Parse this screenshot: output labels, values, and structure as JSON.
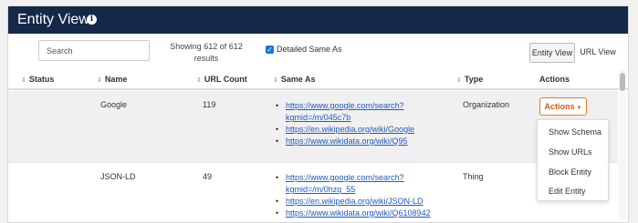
{
  "header": {
    "title": "Entity View",
    "info_icon": "info-circle-icon"
  },
  "controls": {
    "search_placeholder": "Search",
    "showing_line1": "Showing 612 of 612",
    "showing_line2": "results",
    "detailed_label": "Detailed Same As",
    "detailed_checked": true,
    "view_tabs": [
      "Entity View",
      "URL View"
    ]
  },
  "columns": [
    "Status",
    "Name",
    "URL Count",
    "Same As",
    "Type",
    "Actions"
  ],
  "rows": [
    {
      "status": "",
      "name": "Google",
      "url_count": "119",
      "same_as": [
        "https://www.google.com/search?",
        "kgmid=/m/045c7b",
        "https://en.wikipedia.org/wiki/Google",
        "https://www.wikidata.org/wiki/Q95"
      ],
      "type": "Organization",
      "action_label": "Actions"
    },
    {
      "status": "",
      "name": "JSON-LD",
      "url_count": "49",
      "same_as": [
        "https://www.google.com/search?",
        "kgmid=/m/0hzq_55",
        "https://en.wikipedia.org/wiki/JSON-LD",
        "https://www.wikidata.org/wiki/Q6108942"
      ],
      "type": "Thing"
    }
  ],
  "actions_menu": [
    "Show Schema",
    "Show URLs",
    "Block Entity",
    "Edit Entity"
  ],
  "colors": {
    "header_bg": "#15284a",
    "action_accent": "#d05a1a",
    "link": "#1f5bbf"
  }
}
